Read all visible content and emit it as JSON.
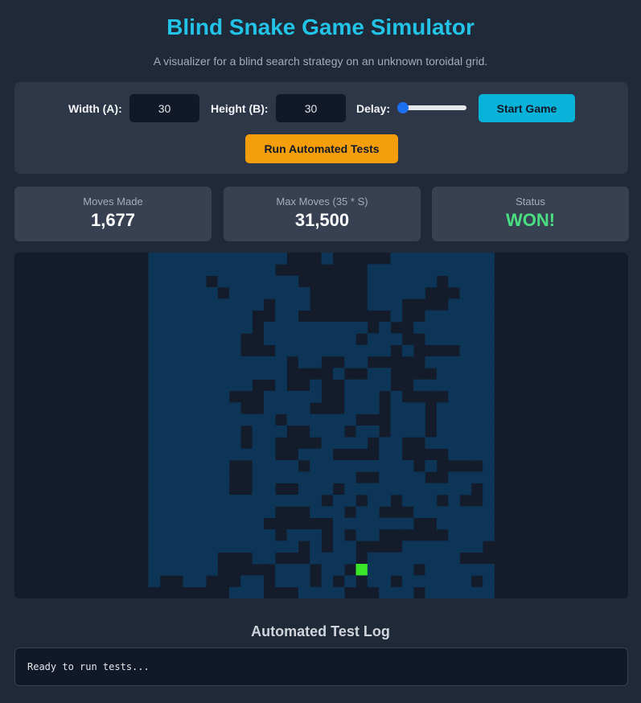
{
  "header": {
    "title": "Blind Snake Game Simulator",
    "subtitle": "A visualizer for a blind search strategy on an unknown toroidal grid."
  },
  "controls": {
    "width_label": "Width (A):",
    "width_value": "30",
    "height_label": "Height (B):",
    "height_value": "30",
    "delay_label": "Delay:",
    "delay_level": 0,
    "start_button": "Start Game",
    "tests_button": "Run Automated Tests"
  },
  "stats": {
    "moves_label": "Moves Made",
    "moves_value": "1,677",
    "max_label": "Max Moves (35 * S)",
    "max_value": "31,500",
    "status_label": "Status",
    "status_value": "WON!"
  },
  "colors": {
    "visited": "#0c3557",
    "unvisited": "#141b2a",
    "snake": "#39e629",
    "accent_title": "#22c3e6",
    "status_won": "#4ade80"
  },
  "grid": {
    "cols": 30,
    "rows": 30,
    "snake_cell": [
      18,
      27
    ],
    "cells": [
      "............###.#####.........",
      "...........########...........",
      ".....#.......######......#....",
      "......#.......#####.....###...",
      "..........#...#####...####....",
      ".........##..########.##......",
      ".........#.........#.##.......",
      "........##........#...##......",
      "........###..........#.####...",
      "............#..##..#####......",
      "............####.##..####.....",
      ".........##.##.##....##.......",
      ".......###.....##...#.####....",
      "........##....###...#...#.....",
      "...........#......###...#.....",
      "........#...##...#..#...#.....",
      "........#..####....#..##......",
      "...........##...####..####....",
      ".......##....#.........#.####.",
      ".......##.........##....##....",
      ".......##..##...#...........#.",
      "...............#..#..#...#.##.",
      "...........###...#..###.......",
      "..........######.......##.....",
      "...........#...#.#..######....",
      ".............#.#..####.......#",
      "......###..###....#........###",
      "......#####...#..#.....#......",
      ".##..###..#...#.#.#..#......#.",
      "#######...###....###...#......"
    ]
  },
  "log": {
    "title": "Automated Test Log",
    "text": "Ready to run tests..."
  }
}
